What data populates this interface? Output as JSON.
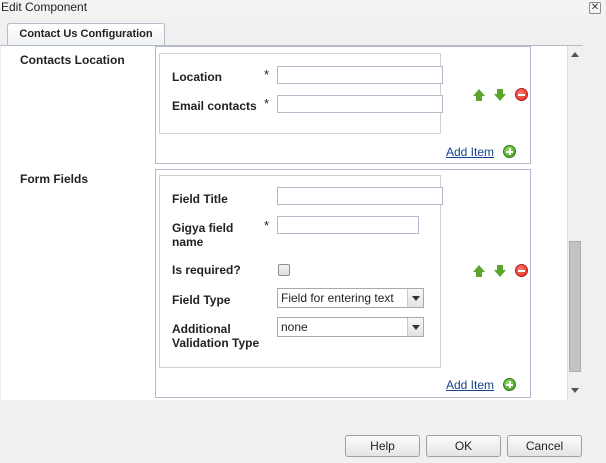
{
  "window": {
    "title": "Edit Component",
    "close_glyph": "✕"
  },
  "tabs": [
    {
      "label": "Contact Us Configuration"
    }
  ],
  "contacts_location": {
    "label": "Contacts Location",
    "fields": [
      {
        "label": "Location",
        "required_mark": "*",
        "value": ""
      },
      {
        "label": "Email contacts",
        "required_mark": "*",
        "value": ""
      }
    ],
    "add_item_label": "Add Item"
  },
  "form_fields": {
    "label": "Form Fields",
    "field_title": {
      "label": "Field Title",
      "value": ""
    },
    "gigya_field_name": {
      "label_line1": "Gigya field",
      "label_line2": "name",
      "required_mark": "*",
      "value": ""
    },
    "is_required": {
      "label": "Is required?",
      "checked": false
    },
    "field_type": {
      "label": "Field Type",
      "selected": "Field for entering text"
    },
    "validation_type": {
      "label_line1": "Additional",
      "label_line2": "Validation Type",
      "selected": "none"
    },
    "add_item_label": "Add Item"
  },
  "icons": {
    "move_up": "arrow-up-icon",
    "move_down": "arrow-down-icon",
    "remove": "remove-icon",
    "add": "add-icon"
  },
  "footer": {
    "help_label": "Help",
    "ok_label": "OK",
    "cancel_label": "Cancel"
  },
  "colors": {
    "link": "#15428b",
    "add_green": "#3b9a1e",
    "remove_red": "#d8261a",
    "arrow_green": "#5aa72c"
  }
}
